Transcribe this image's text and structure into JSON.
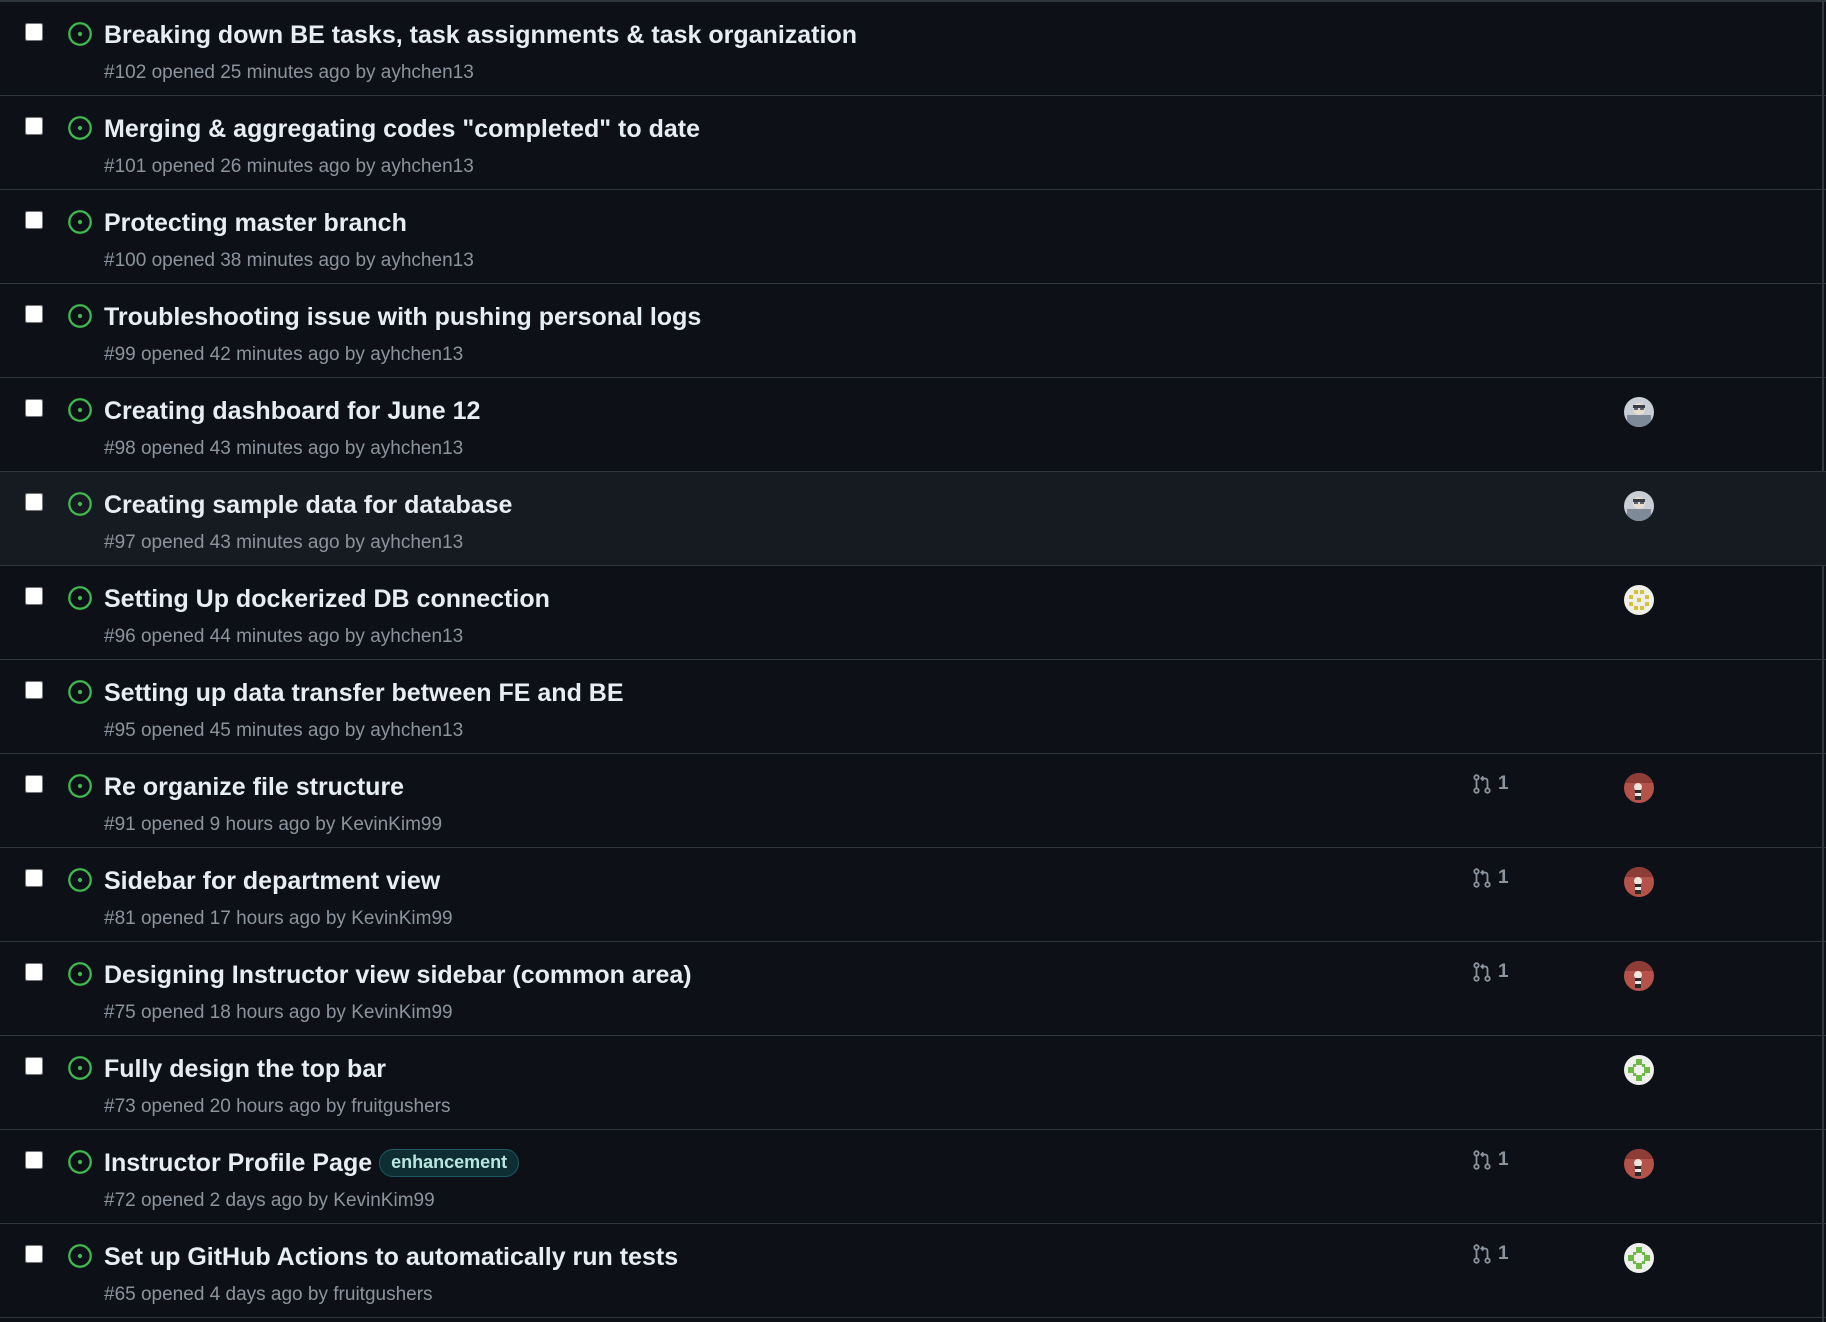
{
  "colors": {
    "background": "#0d1117",
    "hover_background": "#161b22",
    "border": "#30363d",
    "title": "#e6edf3",
    "meta": "#8b949e",
    "open_status": "#3fb950",
    "label_bg": "#0f2e33",
    "label_text": "#b8e6e0"
  },
  "issues": [
    {
      "title": "Breaking down BE tasks, task assignments & task organization",
      "number": "#102",
      "opened_text": "opened 25 minutes ago by",
      "author": "ayhchen13",
      "label": null,
      "linked_pr_count": null,
      "assignee": null,
      "status": "open",
      "status_icon": "issue-opened-icon"
    },
    {
      "title": "Merging & aggregating codes \"completed\" to date",
      "number": "#101",
      "opened_text": "opened 26 minutes ago by",
      "author": "ayhchen13",
      "label": null,
      "linked_pr_count": null,
      "assignee": null,
      "status": "open",
      "status_icon": "issue-opened-icon"
    },
    {
      "title": "Protecting master branch",
      "number": "#100",
      "opened_text": "opened 38 minutes ago by",
      "author": "ayhchen13",
      "label": null,
      "linked_pr_count": null,
      "assignee": null,
      "status": "open",
      "status_icon": "issue-opened-icon"
    },
    {
      "title": "Troubleshooting issue with pushing personal logs",
      "number": "#99",
      "opened_text": "opened 42 minutes ago by",
      "author": "ayhchen13",
      "label": null,
      "linked_pr_count": null,
      "assignee": null,
      "status": "open",
      "status_icon": "issue-opened-icon"
    },
    {
      "title": "Creating dashboard for June 12",
      "number": "#98",
      "opened_text": "opened 43 minutes ago by",
      "author": "ayhchen13",
      "label": null,
      "linked_pr_count": null,
      "assignee": "photo-avatar",
      "status": "open",
      "status_icon": "issue-opened-icon"
    },
    {
      "title": "Creating sample data for database",
      "number": "#97",
      "opened_text": "opened 43 minutes ago by",
      "author": "ayhchen13",
      "label": null,
      "linked_pr_count": null,
      "assignee": "photo-avatar",
      "status": "open",
      "status_icon": "issue-opened-icon",
      "hovered": true
    },
    {
      "title": "Setting Up dockerized DB connection",
      "number": "#96",
      "opened_text": "opened 44 minutes ago by",
      "author": "ayhchen13",
      "label": null,
      "linked_pr_count": null,
      "assignee": "identicon-yellow",
      "status": "open",
      "status_icon": "issue-opened-icon"
    },
    {
      "title": "Setting up data transfer between FE and BE",
      "number": "#95",
      "opened_text": "opened 45 minutes ago by",
      "author": "ayhchen13",
      "label": null,
      "linked_pr_count": null,
      "assignee": null,
      "status": "open",
      "status_icon": "issue-opened-icon"
    },
    {
      "title": "Re organize file structure",
      "number": "#91",
      "opened_text": "opened 9 hours ago by",
      "author": "KevinKim99",
      "label": null,
      "linked_pr_count": "1",
      "assignee": "red-avatar",
      "status": "open",
      "status_icon": "issue-opened-icon"
    },
    {
      "title": "Sidebar for department view",
      "number": "#81",
      "opened_text": "opened 17 hours ago by",
      "author": "KevinKim99",
      "label": null,
      "linked_pr_count": "1",
      "assignee": "red-avatar",
      "status": "open",
      "status_icon": "issue-opened-icon"
    },
    {
      "title": "Designing Instructor view sidebar (common area)",
      "number": "#75",
      "opened_text": "opened 18 hours ago by",
      "author": "KevinKim99",
      "label": null,
      "linked_pr_count": "1",
      "assignee": "red-avatar",
      "status": "open",
      "status_icon": "issue-opened-icon"
    },
    {
      "title": "Fully design the top bar",
      "number": "#73",
      "opened_text": "opened 20 hours ago by",
      "author": "fruitgushers",
      "label": null,
      "linked_pr_count": null,
      "assignee": "identicon-green",
      "status": "open",
      "status_icon": "issue-opened-icon"
    },
    {
      "title": "Instructor Profile Page",
      "number": "#72",
      "opened_text": "opened 2 days ago by",
      "author": "KevinKim99",
      "label": "enhancement",
      "linked_pr_count": "1",
      "assignee": "red-avatar",
      "status": "open",
      "status_icon": "issue-opened-icon"
    },
    {
      "title": "Set up GitHub Actions to automatically run tests",
      "number": "#65",
      "opened_text": "opened 4 days ago by",
      "author": "fruitgushers",
      "label": null,
      "linked_pr_count": "1",
      "assignee": "identicon-green",
      "status": "open",
      "status_icon": "issue-opened-icon"
    }
  ]
}
